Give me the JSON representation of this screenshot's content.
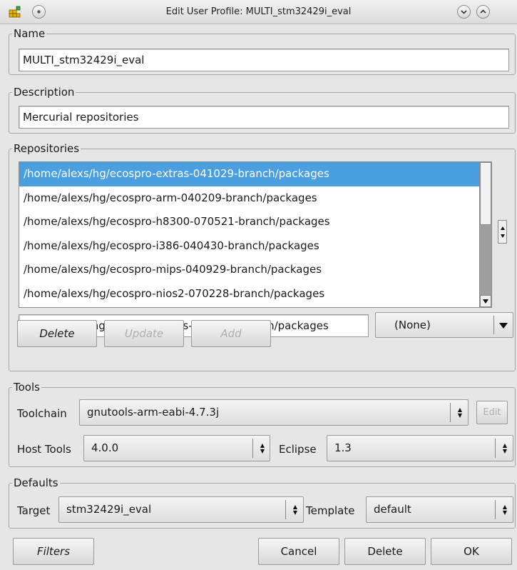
{
  "window": {
    "title": "Edit User Profile: MULTI_stm32429i_eval"
  },
  "name_group": {
    "title": "Name",
    "value": "MULTI_stm32429i_eval"
  },
  "description_group": {
    "title": "Description",
    "value": "Mercurial repositories"
  },
  "repositories_group": {
    "title": "Repositories",
    "items": [
      "/home/alexs/hg/ecospro-extras-041029-branch/packages",
      "/home/alexs/hg/ecospro-arm-040209-branch/packages",
      "/home/alexs/hg/ecospro-h8300-070521-branch/packages",
      "/home/alexs/hg/ecospro-i386-040430-branch/packages",
      "/home/alexs/hg/ecospro-mips-040929-branch/packages",
      "/home/alexs/hg/ecospro-nios2-070228-branch/packages"
    ],
    "selected_index": 0,
    "path_value": "/home/alexs/hg/ecospro-extras-041029-branch/packages",
    "vcs_selected": "(None)",
    "delete_label": "Delete",
    "update_label": "Update",
    "add_label": "Add"
  },
  "tools_group": {
    "title": "Tools",
    "toolchain_label": "Toolchain",
    "toolchain_value": "gnutools-arm-eabi-4.7.3j",
    "edit_label": "Edit",
    "host_tools_label": "Host Tools",
    "host_tools_value": "4.0.0",
    "eclipse_label": "Eclipse",
    "eclipse_value": "1.3"
  },
  "defaults_group": {
    "title": "Defaults",
    "target_label": "Target",
    "target_value": "stm32429i_eval",
    "template_label": "Template",
    "template_value": "default"
  },
  "footer": {
    "filters_label": "Filters",
    "cancel_label": "Cancel",
    "delete_label": "Delete",
    "ok_label": "OK"
  },
  "colors": {
    "selection": "#4a9fe0",
    "background": "#e6e6e6"
  }
}
